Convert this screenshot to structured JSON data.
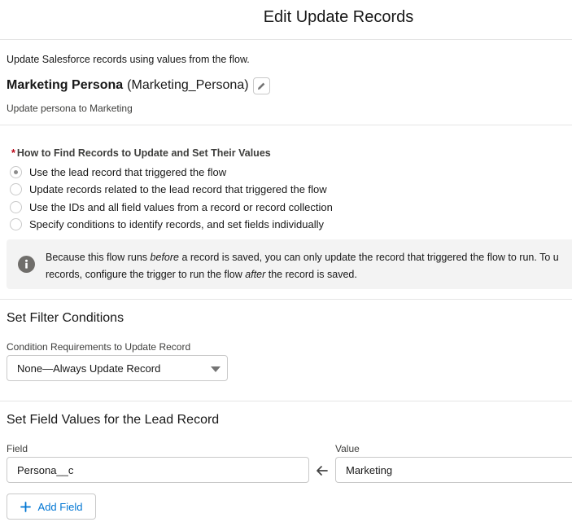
{
  "modal": {
    "title": "Edit Update Records"
  },
  "element": {
    "description_header": "Update Salesforce records using values from the flow.",
    "label": "Marketing Persona",
    "api_name": "(Marketing_Persona)",
    "edit_icon": "pencil-icon",
    "description": "Update persona to Marketing"
  },
  "how_to_find": {
    "required_marker": "*",
    "label": "How to Find Records to Update and Set Their Values",
    "options": [
      {
        "label": "Use the lead record that triggered the flow",
        "selected": true
      },
      {
        "label": "Update records related to the lead record that triggered the flow",
        "selected": false
      },
      {
        "label": "Use the IDs and all field values from a record or record collection",
        "selected": false
      },
      {
        "label": "Specify conditions to identify records, and set fields individually",
        "selected": false
      }
    ]
  },
  "info": {
    "icon": "info-icon",
    "line1_a": "Because this flow runs ",
    "line1_em": "before",
    "line1_b": " a record is saved, you can only update the record that triggered the flow to run. To u",
    "line2_a": "records, configure the trigger to run the flow ",
    "line2_em": "after",
    "line2_b": " the record is saved."
  },
  "filter": {
    "title": "Set Filter Conditions",
    "condition_label": "Condition Requirements to Update Record",
    "condition_value": "None—Always Update Record",
    "caret_icon": "caret-down-icon"
  },
  "field_values": {
    "title": "Set Field Values for the Lead Record",
    "field_label": "Field",
    "value_label": "Value",
    "rows": [
      {
        "field": "Persona__c",
        "value": "Marketing"
      }
    ],
    "arrow_icon": "arrow-left-icon",
    "add_button_label": "Add Field",
    "add_icon": "plus-icon"
  }
}
